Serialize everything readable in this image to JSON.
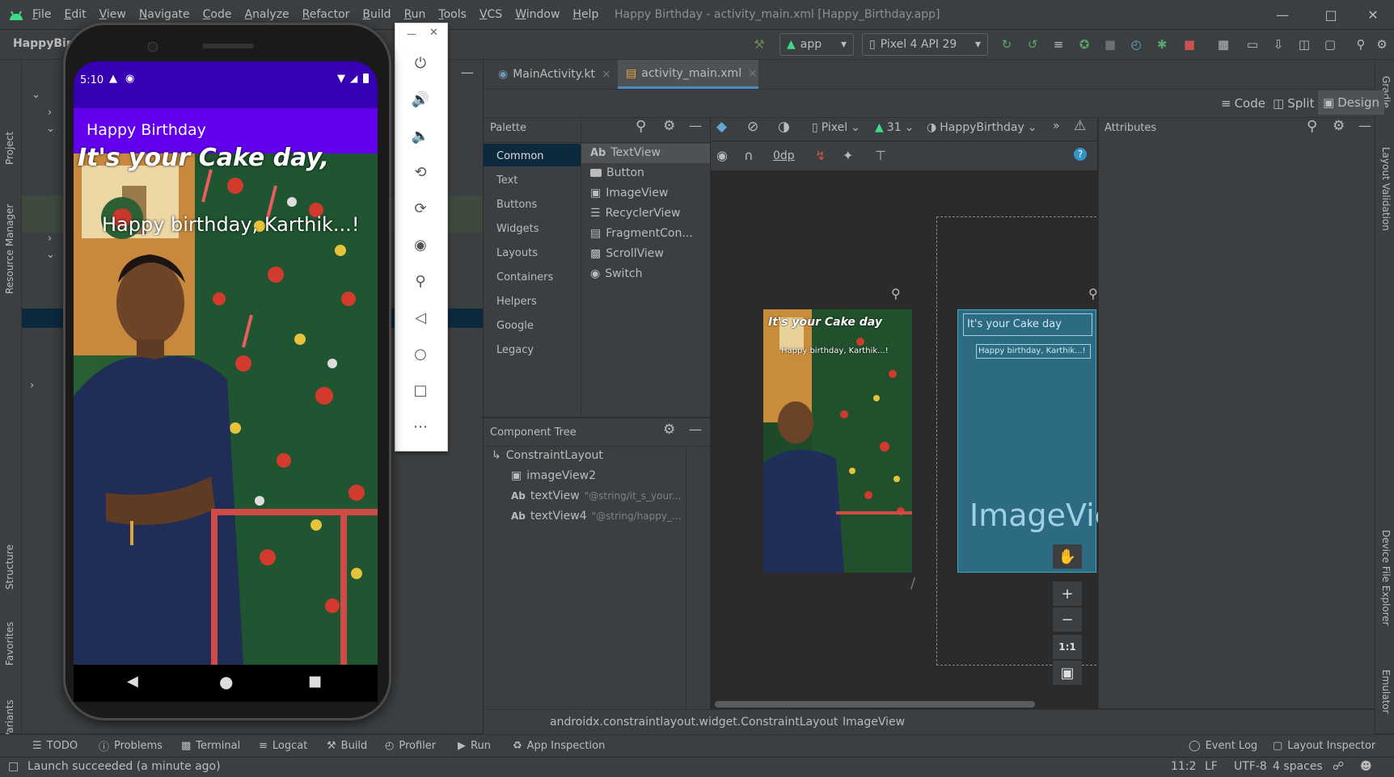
{
  "window": {
    "title": "Happy Birthday - activity_main.xml [Happy_Birthday.app]",
    "menu": [
      "File",
      "Edit",
      "View",
      "Navigate",
      "Code",
      "Analyze",
      "Refactor",
      "Build",
      "Run",
      "Tools",
      "VCS",
      "Window",
      "Help"
    ]
  },
  "toolbar": {
    "project_name": "HappyBir",
    "run_config": "app",
    "device": "Pixel 4 API 29"
  },
  "left_stripe": {
    "project": "Project",
    "resource_manager": "Resource Manager",
    "structure": "Structure",
    "favorites": "Favorites",
    "build_variants": "Build Variants"
  },
  "right_stripe": {
    "gradle": "Gradle",
    "layout_validation": "Layout Validation",
    "device_file_explorer": "Device File Explorer",
    "emulator": "Emulator"
  },
  "editor_tabs": [
    {
      "label": "MainActivity.kt"
    },
    {
      "label": "activity_main.xml"
    }
  ],
  "mode_bar": {
    "code": "Code",
    "split": "Split",
    "design": "Design"
  },
  "palette": {
    "title": "Palette",
    "categories": [
      "Common",
      "Text",
      "Buttons",
      "Widgets",
      "Layouts",
      "Containers",
      "Helpers",
      "Google",
      "Legacy"
    ],
    "items": [
      {
        "icon": "Ab",
        "label": "TextView"
      },
      {
        "icon": "button-icon",
        "label": "Button"
      },
      {
        "icon": "image-icon",
        "label": "ImageView"
      },
      {
        "icon": "list-icon",
        "label": "RecyclerView"
      },
      {
        "icon": "fragment-icon",
        "label": "FragmentCon..."
      },
      {
        "icon": "scroll-icon",
        "label": "ScrollView"
      },
      {
        "icon": "switch-icon",
        "label": "Switch"
      }
    ]
  },
  "design_toolbar": {
    "device": "Pixel",
    "api": "31",
    "theme": "HappyBirthday",
    "margin": "0dp"
  },
  "attributes": {
    "title": "Attributes"
  },
  "component_tree": {
    "title": "Component Tree",
    "root": "ConstraintLayout",
    "children": [
      {
        "label": "imageView2",
        "detail": ""
      },
      {
        "label": "textView",
        "detail": "\"@string/it_s_your..."
      },
      {
        "label": "textView4",
        "detail": "\"@string/happy_..."
      }
    ]
  },
  "preview": {
    "title_text": "It's your Cake day",
    "subtitle_text": "Happy birthday, Karthik...!",
    "blueprint_image_label": "ImageVie"
  },
  "zoom": {
    "one_to_one": "1:1"
  },
  "breadcrumb": {
    "root": "androidx.constraintlayout.widget.ConstraintLayout",
    "leaf": "ImageView"
  },
  "emulator": {
    "time": "5:10",
    "app_title": "Happy Birthday",
    "headline": "It's your Cake day,",
    "message": "Happy birthday, Karthik...!"
  },
  "bottom_tools": [
    "TODO",
    "Problems",
    "Terminal",
    "Logcat",
    "Build",
    "Profiler",
    "Run",
    "App Inspection"
  ],
  "bottom_tools_right": [
    "Event Log",
    "Layout Inspector"
  ],
  "status": {
    "message": "Launch succeeded (a minute ago)",
    "position": "11:2",
    "line_sep": "LF",
    "encoding": "UTF-8",
    "indent": "4 spaces"
  },
  "colors": {
    "accent": "#6200ee",
    "status_bar": "#3700b3",
    "ide_bg": "#2b2b2b",
    "panel_bg": "#3c3f41",
    "blueprint": "#2d6b82"
  }
}
